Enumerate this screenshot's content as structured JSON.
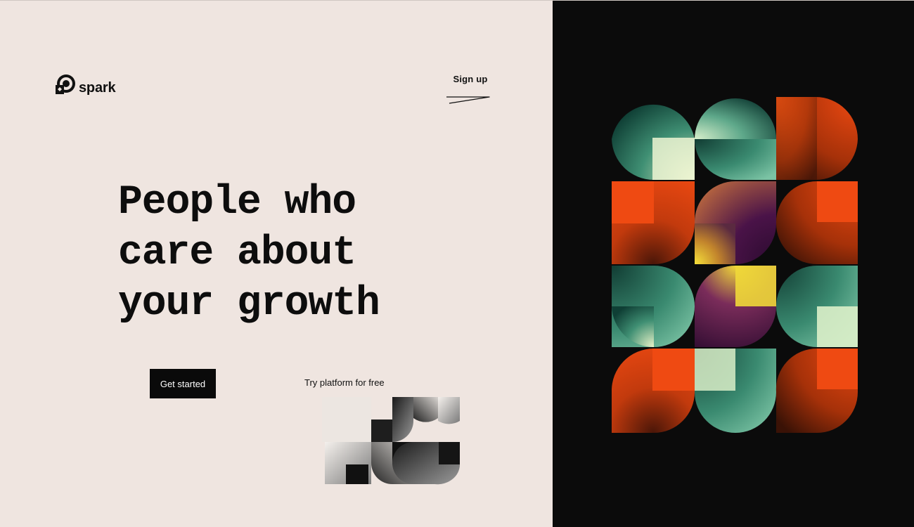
{
  "brand": {
    "name": "spark",
    "logo_icon": "spark-logo-icon"
  },
  "header": {
    "signup_label": "Sign up"
  },
  "hero": {
    "line1": "People who",
    "line2": "care about",
    "line3": "your growth"
  },
  "cta": {
    "primary_label": "Get started",
    "secondary_label": "Try platform for free"
  },
  "illustrations": {
    "small": "grayscale-geometric-pattern",
    "poster": "colorful-geometric-poster"
  },
  "colors": {
    "page_background": "#efe5e0",
    "panel_background": "#0b0b0b",
    "text": "#0d0d0d",
    "button_background": "#0a0a0a",
    "poster_green": "#3f8f73",
    "poster_orange": "#ef4a12",
    "poster_purple": "#4a1348",
    "poster_yellow": "#f0d838"
  }
}
